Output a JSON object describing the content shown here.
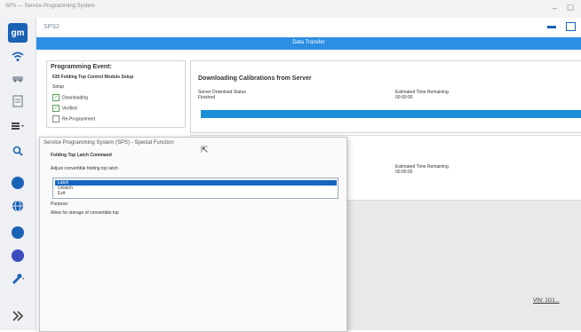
{
  "window": {
    "title": "SPS — Service Programming System",
    "controls": [
      "–",
      "☐"
    ]
  },
  "rail": {
    "logo": "gm",
    "icons": [
      "wifi-icon",
      "car-icon",
      "module-icon",
      "menu-icon",
      "search-icon",
      "gauge-icon",
      "globe-icon",
      "circle-icon",
      "circle-icon-2",
      "wrench-icon",
      "expand-icon"
    ]
  },
  "header": {
    "app_name": "SPS2",
    "banner": "Data Transfer"
  },
  "programming": {
    "heading": "Programming Event:",
    "event": "635 Folding Top Control Module Setup",
    "subheading": "Setup",
    "steps": [
      {
        "label": "Downloading",
        "checked": true
      },
      {
        "label": "Verified",
        "checked": true
      },
      {
        "label": "Re-Programmed",
        "checked": false
      }
    ]
  },
  "download": {
    "title": "Downloading Calibrations from Server",
    "status_label": "Server Download Status",
    "status_value": "Finished",
    "time_label": "Estimated Time Remaining",
    "time_value": "00:00:00",
    "progress": 1.0
  },
  "lower": {
    "time_label": "Estimated Time Remaining",
    "time_value": "00:00:00"
  },
  "vin": "VIN: 1G1...",
  "dialog": {
    "title": "Service Programming System (SPS) - Special Function",
    "section": "Folding Top Latch Command",
    "prompt": "Adjust convertible folding top latch",
    "options": [
      "Latch",
      "Unlatch",
      "Exit"
    ],
    "selected_index": 0,
    "purpose_label": "Purpose:",
    "purpose_text": "Allow for storage of convertible top"
  },
  "colors": {
    "accent": "#2c8fe3",
    "progress": "#1b8fd6",
    "selection": "#1565c0"
  }
}
